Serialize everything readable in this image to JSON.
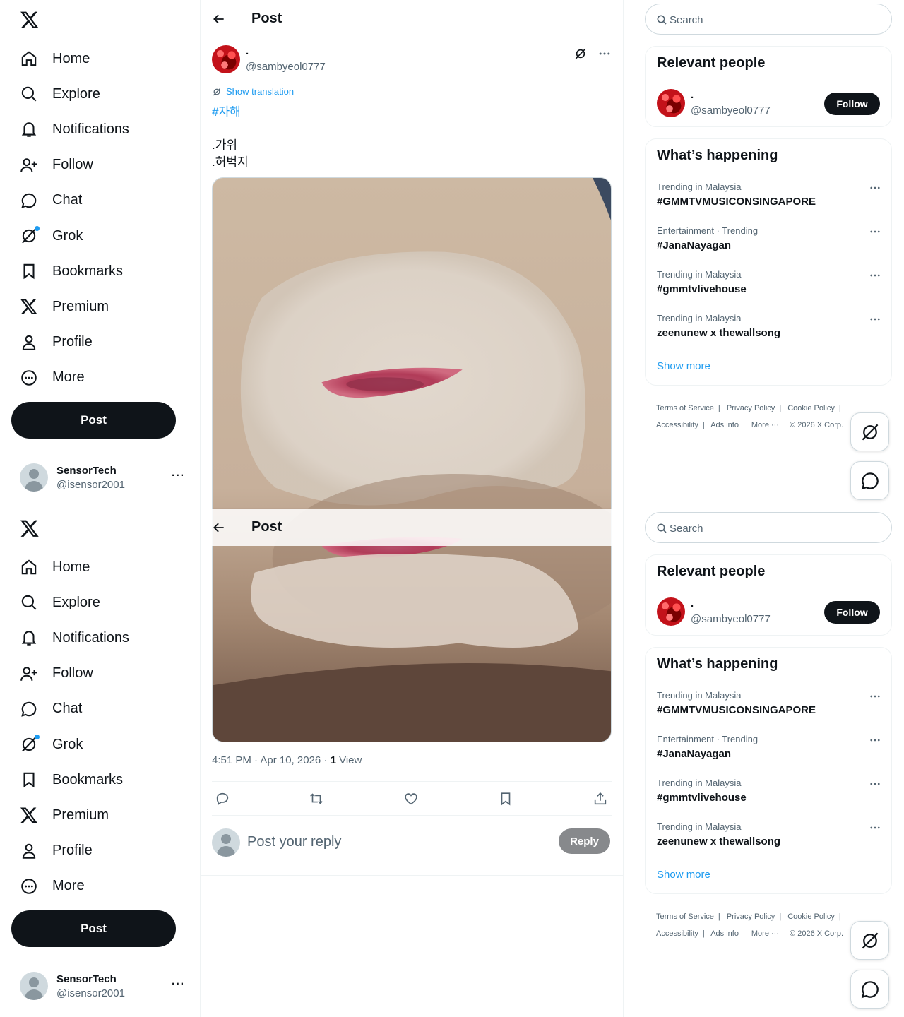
{
  "nav": {
    "items": [
      {
        "label": "Home",
        "icon": "home-icon"
      },
      {
        "label": "Explore",
        "icon": "search-icon"
      },
      {
        "label": "Notifications",
        "icon": "bell-icon"
      },
      {
        "label": "Follow",
        "icon": "add-person-icon"
      },
      {
        "label": "Chat",
        "icon": "chat-icon"
      },
      {
        "label": "Grok",
        "icon": "grok-icon"
      },
      {
        "label": "Bookmarks",
        "icon": "bookmark-icon"
      },
      {
        "label": "Premium",
        "icon": "x-logo-icon"
      },
      {
        "label": "Profile",
        "icon": "person-icon"
      },
      {
        "label": "More",
        "icon": "more-circle-icon"
      }
    ],
    "post_button": "Post",
    "account": {
      "name": "SensorTech",
      "handle": "@isensor2001",
      "more": "···"
    }
  },
  "main": {
    "header_title": "Post",
    "post": {
      "author_name": ".",
      "author_handle": "@sambyeol0777",
      "show_translation": "Show translation",
      "hashtag": "#자해",
      "text": ".가위\n.허벅지",
      "timestamp": "4:51 PM · Apr 10, 2026 · ",
      "views_count": "1",
      "views_label": " View"
    },
    "reply": {
      "placeholder": "Post your reply",
      "button": "Reply"
    }
  },
  "sidebar": {
    "search_placeholder": "Search",
    "relevant_people": {
      "title": "Relevant people",
      "person": {
        "name": ".",
        "handle": "@sambyeol0777",
        "button": "Follow"
      }
    },
    "whats_happening": {
      "title": "What’s happening",
      "trends": [
        {
          "meta": "Trending in Malaysia",
          "name": "#GMMTVMUSICONSINGAPORE"
        },
        {
          "meta": "Entertainment · Trending",
          "name": "#JanaNayagan"
        },
        {
          "meta": "Trending in Malaysia",
          "name": "#gmmtvlivehouse"
        },
        {
          "meta": "Trending in Malaysia",
          "name": "zeenunew x thewallsong"
        }
      ],
      "show_more": "Show more"
    },
    "footer": {
      "terms": "Terms of Service",
      "privacy": "Privacy Policy",
      "cookie": "Cookie Policy",
      "accessibility": "Accessibility",
      "ads": "Ads info",
      "more": "More ···",
      "copyright": "© 2026 X Corp."
    }
  }
}
